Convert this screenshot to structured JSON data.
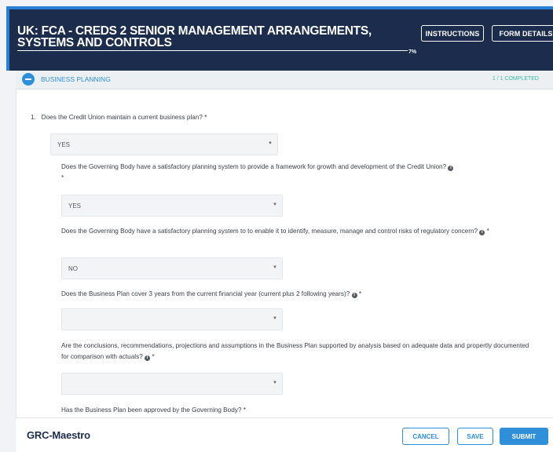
{
  "header": {
    "title": "UK: FCA - CREDS 2 SENIOR MANAGEMENT ARRANGEMENTS, SYSTEMS AND CONTROLS",
    "progress_pct": "7%",
    "progress_fraction": 0.07,
    "instructions_label": "INSTRUCTIONS",
    "form_details_label": "FORM DETAILS"
  },
  "section": {
    "title": "BUSINESS PLANNING",
    "status": "1 / 1 COMPLETED"
  },
  "questions": [
    {
      "number": "1.",
      "text": "Does the Credit Union maintain a current business plan?",
      "required": "*",
      "answer": "YES"
    },
    {
      "text": "Does the Governing Body have a satisfactory planning system to provide a framework for growth and development of the Credit Union?",
      "required": "*",
      "answer": "YES"
    },
    {
      "text": "Does the Governing Body have a satisfactory planning system to to enable it to identify, measure, manage and control risks of regulatory concern?",
      "required": "*",
      "answer": "NO"
    },
    {
      "text": "Does the Business Plan cover 3 years from the current financial year (current plus 2 following years)?",
      "required": "*",
      "answer": ""
    },
    {
      "text": "Are the conclusions, recommendations, projections and assumptions in the Business Plan supported by analysis based on adequate data and propertly documented for comparison with actuals?",
      "required": "*",
      "answer": ""
    },
    {
      "text": "Has the Business Plan been approved by the Governing Body?",
      "required": "*"
    }
  ],
  "footer": {
    "logo_grc": "GRC",
    "logo_rest": "-Maestro",
    "cancel_label": "CANCEL",
    "save_label": "SAVE",
    "submit_label": "SUBMIT"
  },
  "colors": {
    "header_bg": "#1b2c4c",
    "accent": "#2f8fd8",
    "completed": "#3bb9a8"
  },
  "icons": {
    "collapse": "minus-circle-icon",
    "info": "info-circle-icon",
    "dropdown": "caret-down-icon"
  }
}
